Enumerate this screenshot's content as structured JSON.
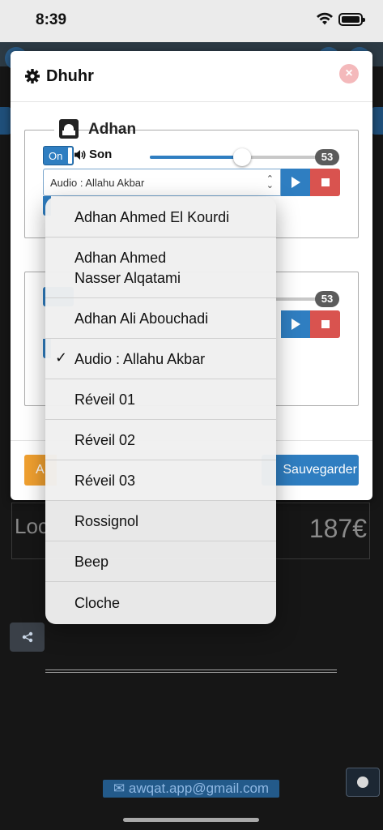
{
  "status": {
    "time": "8:39"
  },
  "background": {
    "location_label": "Loc",
    "price": "187€",
    "email": "awqat.app@gmail.com"
  },
  "modal": {
    "title": "Dhuhr",
    "section": {
      "legend": "Adhan",
      "toggle_label": "On",
      "sound_label": "Son",
      "volume": 53,
      "volume_display": "53",
      "selected_audio": "Audio : Allahu Akbar"
    },
    "section2": {
      "volume_display": "53"
    },
    "footer": {
      "cancel_label": "A",
      "save_label": "Sauvegarder"
    }
  },
  "dropdown": {
    "items": [
      {
        "label": "Adhan Ahmed El Kourdi",
        "selected": false
      },
      {
        "label": "Adhan Ahmed\nNasser Alqatami",
        "selected": false
      },
      {
        "label": "Adhan Ali Abouchadi",
        "selected": false
      },
      {
        "label": "Audio : Allahu Akbar",
        "selected": true
      },
      {
        "label": "Réveil 01",
        "selected": false
      },
      {
        "label": "Réveil 02",
        "selected": false
      },
      {
        "label": "Réveil 03",
        "selected": false
      },
      {
        "label": "Rossignol",
        "selected": false
      },
      {
        "label": "Beep",
        "selected": false
      },
      {
        "label": "Cloche",
        "selected": false
      }
    ],
    "check_glyph": "✓"
  }
}
